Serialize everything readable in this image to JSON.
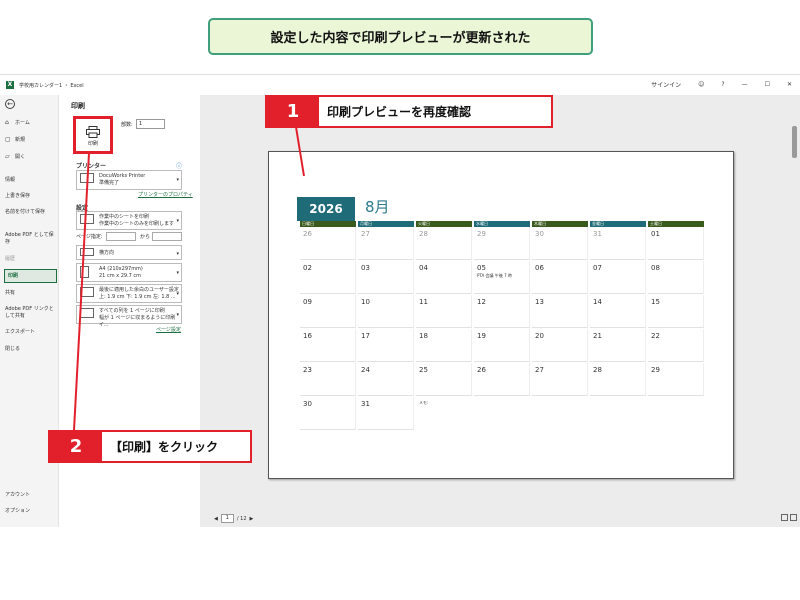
{
  "banner": "設定した内容で印刷プレビューが更新された",
  "window": {
    "app_title": "学校用カレンダー1 ・ Excel",
    "signin": "サインイン",
    "help": "?",
    "minimize": "—",
    "close": "✕"
  },
  "nav": {
    "home": "ホーム",
    "new": "新規",
    "open": "開く",
    "info": "情報",
    "save": "上書き保存",
    "save_as": "名前を付けて保存",
    "adobe_save": "Adobe PDF として保存",
    "history": "履歴",
    "print": "印刷",
    "share": "共有",
    "adobe_share": "Adobe PDF リンクとして共有",
    "export": "エクスポート",
    "close": "閉じる",
    "account": "アカウント",
    "options": "オプション"
  },
  "print_panel": {
    "title": "印刷",
    "print_button": "印刷",
    "copies_label": "部数:",
    "copies_value": "1",
    "printer_heading": "プリンター",
    "printer_name": "DocuWorks Printer",
    "printer_status": "準備完了",
    "printer_props": "プリンターのプロパティ",
    "settings_heading": "設定",
    "sheet_option_1": "作業中のシートを印刷",
    "sheet_option_2": "作業中のシートのみを印刷します",
    "pages_label": "ページ指定:",
    "pages_to": "から",
    "orientation": "横方向",
    "paper_1": "A4 (210x297mm)",
    "paper_2": "21 cm x 29.7 cm",
    "margin_1": "最後に適用した余白のユーザー設定",
    "margin_2": "上: 1.9 cm 下: 1.9 cm 左: 1.8 ...",
    "scale_1": "すべての列を 1 ページに印刷",
    "scale_2": "幅が 1 ページに収まるように印刷イ...",
    "page_setup": "ページ設定"
  },
  "preview": {
    "page_current": "1",
    "page_total": "/ 12"
  },
  "calendar": {
    "year": "2026",
    "month": "8月",
    "weekdays": [
      "日曜日",
      "月曜日",
      "火曜日",
      "水曜日",
      "木曜日",
      "金曜日",
      "土曜日"
    ],
    "weekday_colors": [
      "#3a5a1e",
      "#1f6b78",
      "#3a5a1e",
      "#1f6b78",
      "#3a5a1e",
      "#1f6b78",
      "#3a5a1e"
    ],
    "weeks": [
      [
        {
          "d": "26",
          "dim": true
        },
        {
          "d": "27",
          "dim": true
        },
        {
          "d": "28",
          "dim": true
        },
        {
          "d": "29",
          "dim": true
        },
        {
          "d": "30",
          "dim": true
        },
        {
          "d": "31",
          "dim": true
        },
        {
          "d": "01",
          "dim": false
        }
      ],
      [
        {
          "d": "02"
        },
        {
          "d": "03"
        },
        {
          "d": "04"
        },
        {
          "d": "05",
          "ev": "PTA 会議 午後 7 時"
        },
        {
          "d": "06"
        },
        {
          "d": "07"
        },
        {
          "d": "08"
        }
      ],
      [
        {
          "d": "09"
        },
        {
          "d": "10"
        },
        {
          "d": "11"
        },
        {
          "d": "12"
        },
        {
          "d": "13"
        },
        {
          "d": "14"
        },
        {
          "d": "15"
        }
      ],
      [
        {
          "d": "16"
        },
        {
          "d": "17"
        },
        {
          "d": "18"
        },
        {
          "d": "19"
        },
        {
          "d": "20"
        },
        {
          "d": "21"
        },
        {
          "d": "22"
        }
      ],
      [
        {
          "d": "23"
        },
        {
          "d": "24"
        },
        {
          "d": "25"
        },
        {
          "d": "26"
        },
        {
          "d": "27"
        },
        {
          "d": "28"
        },
        {
          "d": "29"
        }
      ],
      [
        {
          "d": "30"
        },
        {
          "d": "31"
        }
      ]
    ],
    "memo_label": "メモ:"
  },
  "callouts": {
    "step1_num": "1",
    "step1_text": "印刷プレビューを再度確認",
    "step2_num": "2",
    "step2_text": "【印刷】をクリック"
  },
  "colors": {
    "accent_red": "#e2202c",
    "excel_green": "#1d6f42",
    "banner_bg": "#eaf6d6",
    "banner_border": "#3f9f7d"
  }
}
